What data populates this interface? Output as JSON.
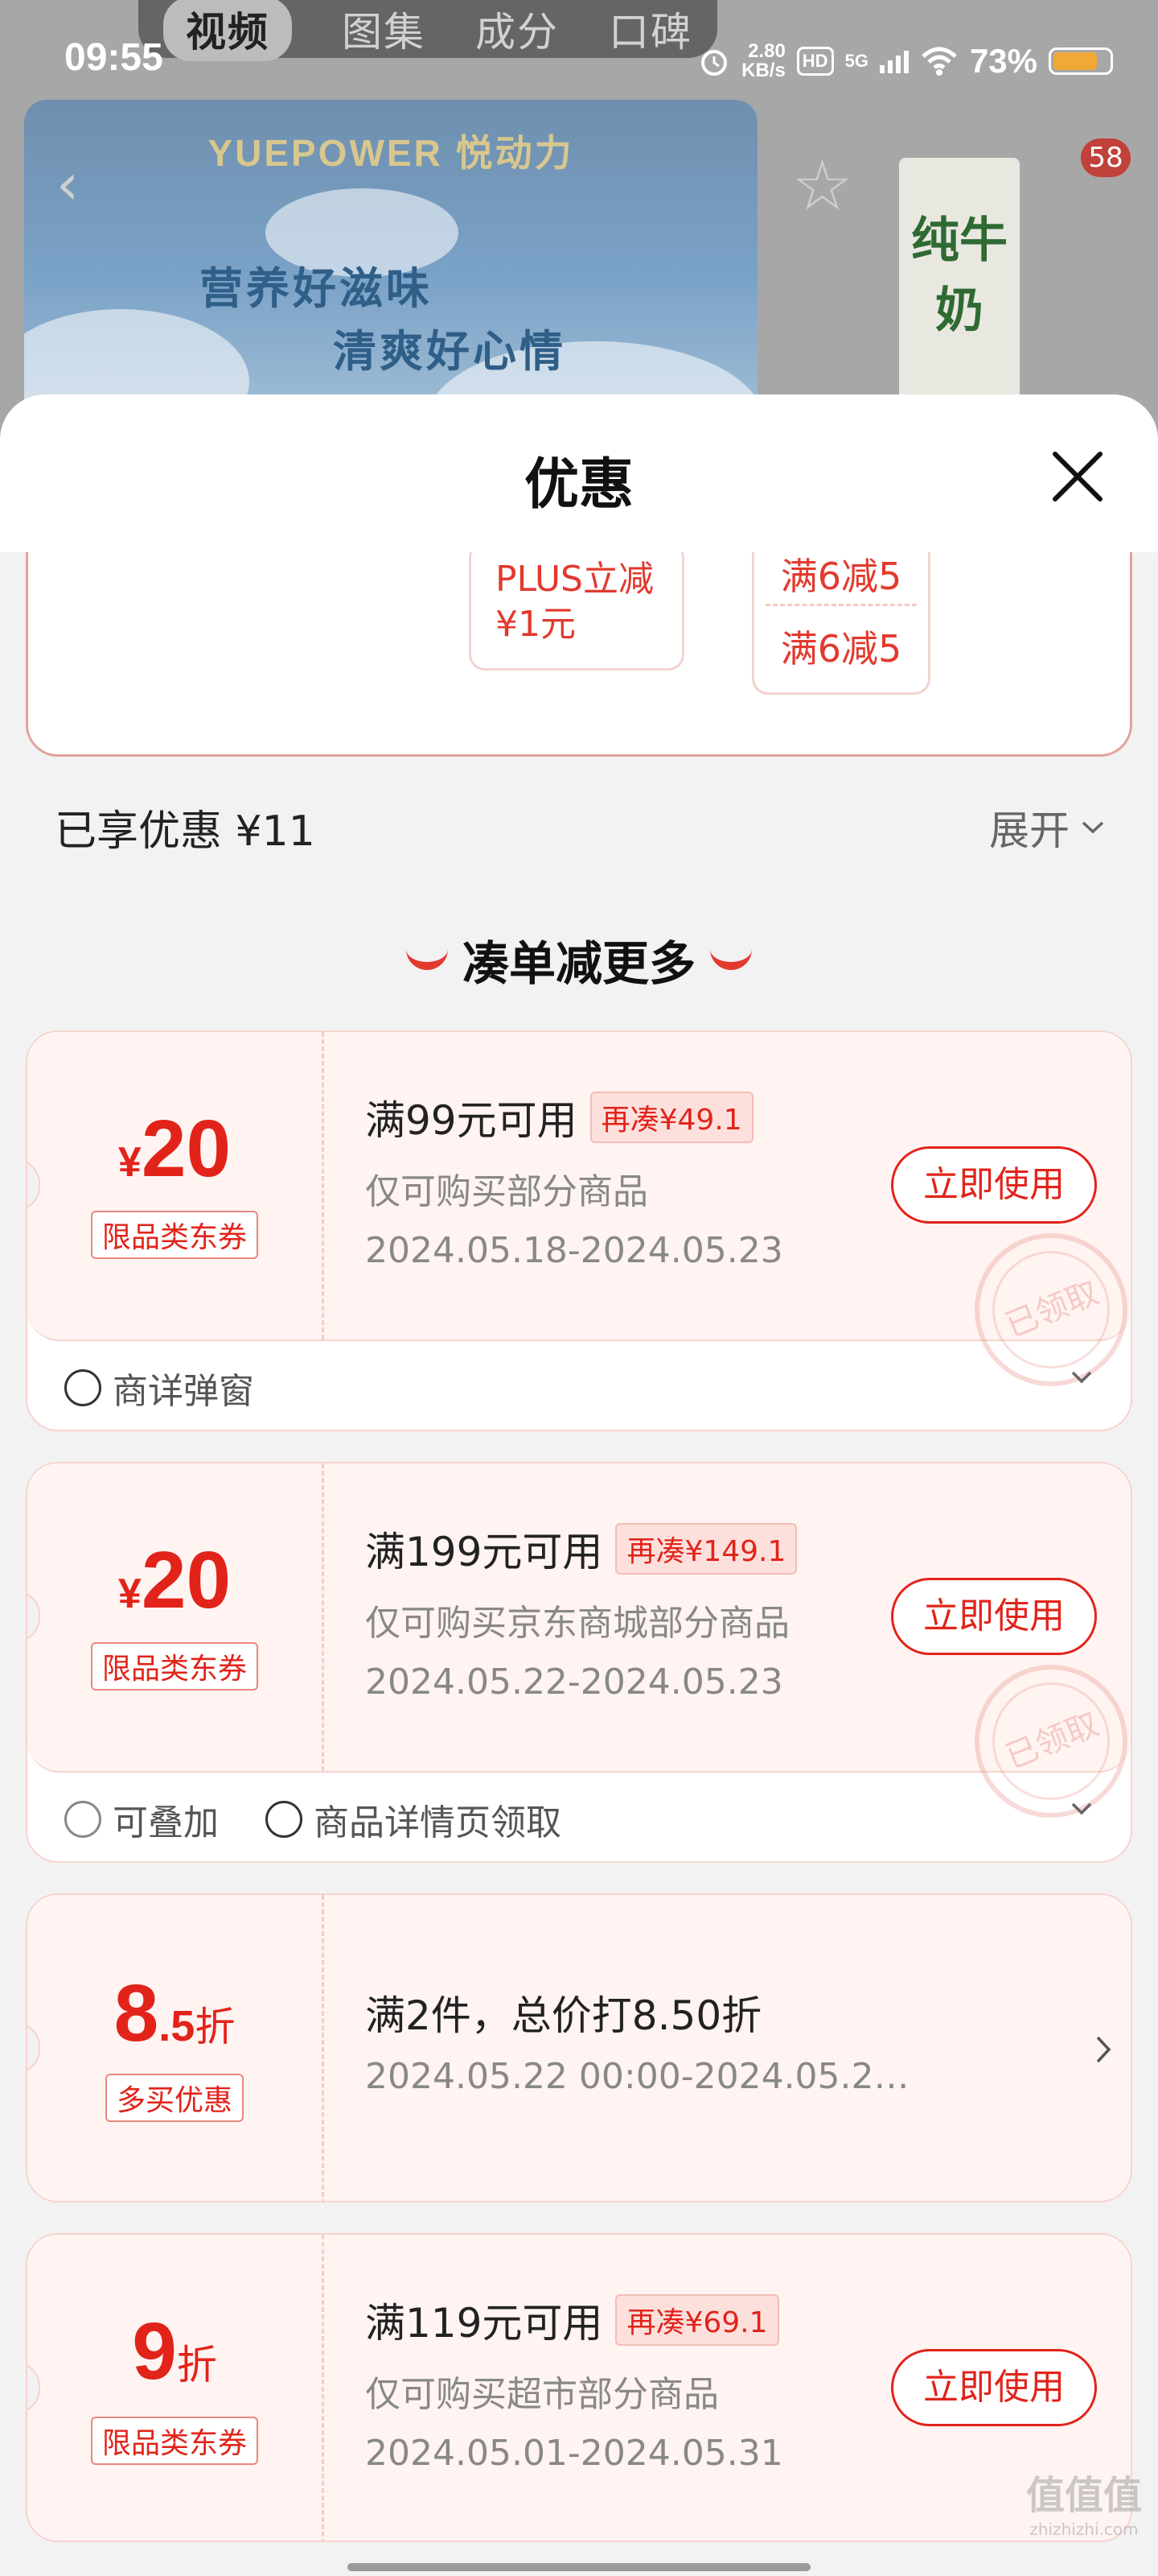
{
  "status_bar": {
    "time": "09:55",
    "speed_value": "2.80",
    "speed_unit": "KB/s",
    "hd": "HD",
    "network": "5G",
    "battery": "73%",
    "battery_level": 0.73
  },
  "top_tabs": [
    "视频",
    "图集",
    "成分",
    "口碑"
  ],
  "background": {
    "brand": "YUEPOWER 悦动力",
    "slogan_line1": "营养好滋味",
    "slogan_line2": "清爽好心情",
    "cart_badge": "58",
    "thumb_text": "纯牛奶"
  },
  "sheet": {
    "title": "优惠",
    "plus_discount": {
      "line1": "PLUS立减",
      "line2": "¥1元"
    },
    "full_reduction": {
      "line1": "满6减5",
      "line2": "满6减5"
    },
    "enjoyed": "已享优惠 ¥11",
    "expand": "展开",
    "section_title": "凑单减更多"
  },
  "coupons": [
    {
      "currency": "¥",
      "amount": "20",
      "tag": "限品类东券",
      "title": "满99元可用",
      "extra": "再凑¥49.1",
      "desc": "仅可购买部分商品",
      "dates": "2024.05.18-2024.05.23",
      "button": "立即使用",
      "stamp": "已领取",
      "footer": [
        {
          "icon": "source-icon",
          "text": "商详弹窗"
        }
      ]
    },
    {
      "currency": "¥",
      "amount": "20",
      "tag": "限品类东券",
      "title": "满199元可用",
      "extra": "再凑¥149.1",
      "desc": "仅可购买京东商城部分商品",
      "dates": "2024.05.22-2024.05.23",
      "button": "立即使用",
      "stamp": "已领取",
      "footer": [
        {
          "icon": "stack-icon",
          "text": "可叠加"
        },
        {
          "icon": "source-icon",
          "text": "商品详情页领取"
        }
      ]
    },
    {
      "amount": "8",
      "decimal": ".5",
      "unit": "折",
      "tag": "多买优惠",
      "title": "满2件，总价打8.50折",
      "dates": "2024.05.22 00:00-2024.05.2…"
    },
    {
      "amount": "9",
      "unit": "折",
      "tag": "限品类东券",
      "title": "满119元可用",
      "extra": "再凑¥69.1",
      "desc": "仅可购买超市部分商品",
      "dates": "2024.05.01-2024.05.31",
      "button": "立即使用"
    }
  ],
  "watermark": {
    "main": "值值值",
    "sub": "zhizhizhi.com"
  },
  "colors": {
    "accent": "#e2231a",
    "coupon_bg": "#fff4f2",
    "sheet_bg": "#f2f2f2"
  }
}
